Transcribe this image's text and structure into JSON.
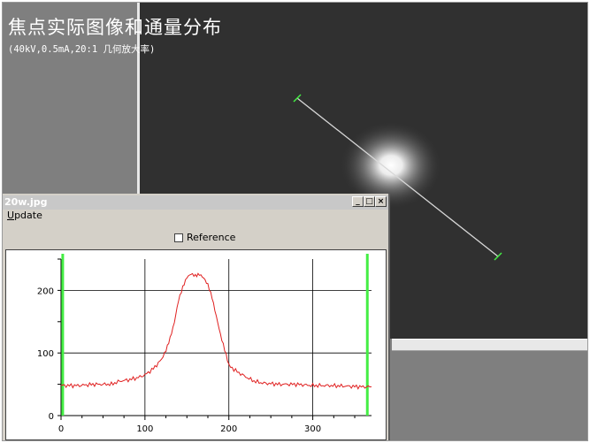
{
  "header": {
    "title": "焦点实际图像和通量分布",
    "subtitle": "(40kV,0.5mA,20:1 几何放大率)"
  },
  "profile_window": {
    "title": "20w.jpg",
    "menu": {
      "update_label": "Update",
      "update_mnemonic": "U",
      "update_rest": "pdate"
    },
    "buttons": {
      "minimize": "_",
      "maximize": "□",
      "close": "×"
    },
    "reference_label": "Reference",
    "reference_checked": false
  },
  "colors": {
    "profile_line": "#e02020",
    "marker": "#44ee44",
    "image_background": "#303030"
  },
  "chart_data": {
    "type": "line",
    "title": "",
    "xlabel": "",
    "ylabel": "",
    "xlim": [
      0,
      370
    ],
    "ylim": [
      0,
      250
    ],
    "x_ticks": [
      "0",
      "100",
      "200",
      "300"
    ],
    "y_ticks": [
      "0",
      "100",
      "200"
    ],
    "grid": true,
    "markers_x": [
      2,
      365
    ],
    "series": [
      {
        "x": [
          0,
          20,
          40,
          60,
          70,
          80,
          90,
          100,
          110,
          120,
          125,
          130,
          135,
          140,
          145,
          150,
          155,
          160,
          165,
          170,
          175,
          180,
          185,
          190,
          195,
          200,
          210,
          220,
          230,
          240,
          260,
          280,
          300,
          320,
          340,
          360,
          370
        ],
        "values": [
          48,
          48,
          50,
          50,
          55,
          57,
          60,
          65,
          75,
          90,
          105,
          125,
          150,
          185,
          205,
          220,
          225,
          222,
          225,
          220,
          210,
          190,
          160,
          130,
          105,
          80,
          70,
          62,
          55,
          52,
          50,
          50,
          48,
          48,
          47,
          46,
          46
        ]
      }
    ]
  }
}
